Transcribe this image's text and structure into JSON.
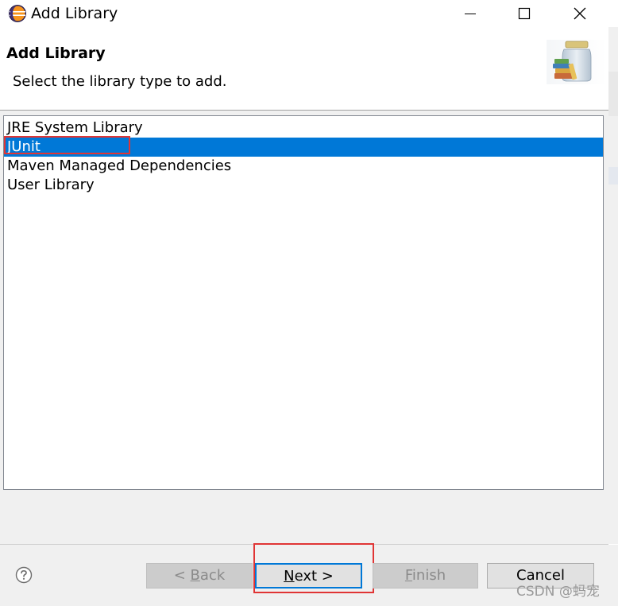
{
  "window": {
    "title": "Add Library",
    "app_icon": "eclipse-icon",
    "controls": {
      "minimize": "minimize-icon",
      "maximize": "maximize-icon",
      "close": "close-icon"
    }
  },
  "header": {
    "title": "Add Library",
    "description": "Select the library type to add.",
    "banner_icon": "library-jar-icon"
  },
  "library_types": {
    "items": [
      {
        "label": "JRE System Library",
        "selected": false
      },
      {
        "label": "JUnit",
        "selected": true
      },
      {
        "label": "Maven Managed Dependencies",
        "selected": false
      },
      {
        "label": "User Library",
        "selected": false
      }
    ]
  },
  "footer": {
    "help_icon": "help-icon",
    "buttons": {
      "back": {
        "label": "< Back",
        "mnemonic": "B",
        "enabled": false
      },
      "next": {
        "label": "Next >",
        "mnemonic": "N",
        "enabled": true,
        "default": true
      },
      "finish": {
        "label": "Finish",
        "mnemonic": "F",
        "enabled": false
      },
      "cancel": {
        "label": "Cancel",
        "enabled": true
      }
    }
  },
  "watermark": "CSDN @蚂宠",
  "colors": {
    "selection": "#0078d7",
    "annotation": "#e03535",
    "panel": "#f0f0f0"
  }
}
